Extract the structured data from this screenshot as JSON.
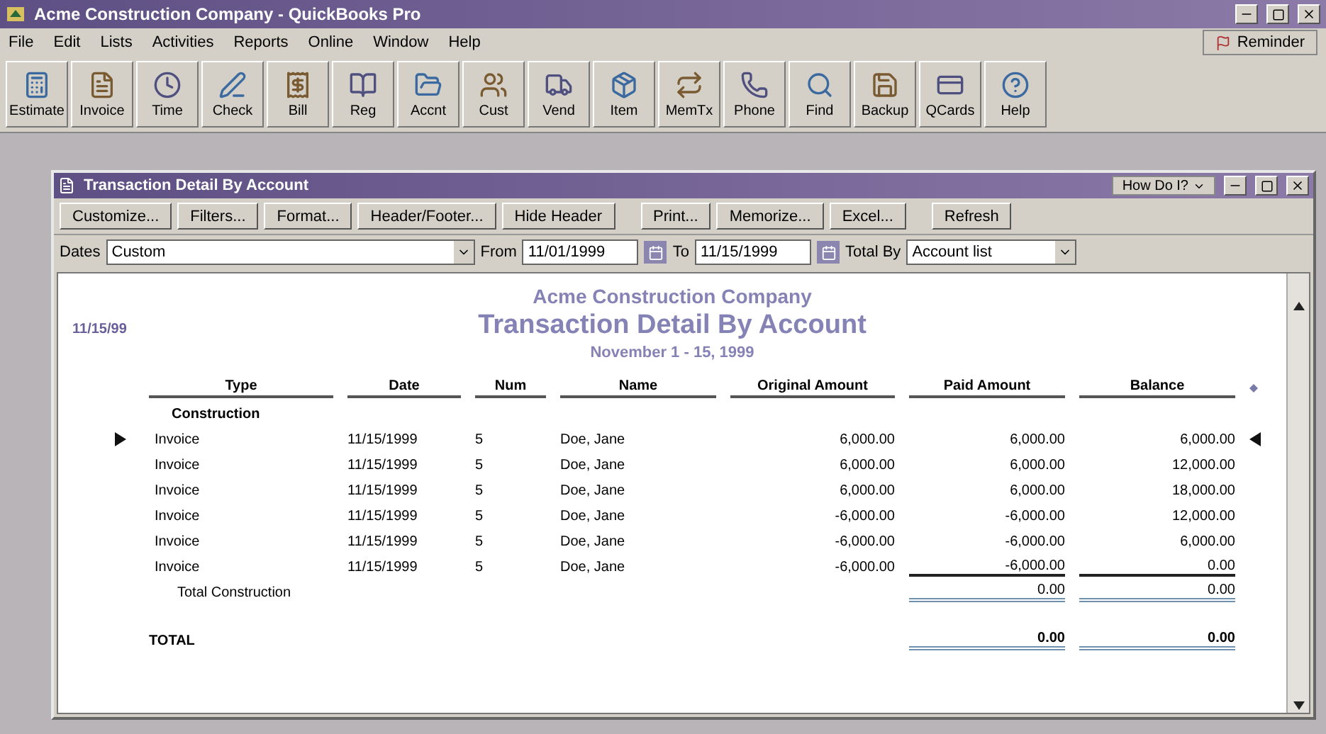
{
  "window": {
    "title": "Acme Construction Company - QuickBooks Pro"
  },
  "menu": [
    "File",
    "Edit",
    "Lists",
    "Activities",
    "Reports",
    "Online",
    "Window",
    "Help"
  ],
  "reminder": "Reminder",
  "toolbar": [
    "Estimate",
    "Invoice",
    "Time",
    "Check",
    "Bill",
    "Reg",
    "Accnt",
    "Cust",
    "Vend",
    "Item",
    "MemTx",
    "Phone",
    "Find",
    "Backup",
    "QCards",
    "Help"
  ],
  "report_window": {
    "title": "Transaction Detail By Account",
    "help": "How Do I?",
    "buttons": [
      "Customize...",
      "Filters...",
      "Format...",
      "Header/Footer...",
      "Hide Header",
      "Print...",
      "Memorize...",
      "Excel...",
      "Refresh"
    ],
    "filters": {
      "dates_label": "Dates",
      "dates": "Custom",
      "from_label": "From",
      "from": "11/01/1999",
      "to_label": "To",
      "to": "11/15/1999",
      "total_by_label": "Total By",
      "total_by": "Account list"
    }
  },
  "report": {
    "date": "11/15/99",
    "company": "Acme Construction Company",
    "title": "Transaction Detail By Account",
    "period": "November 1 - 15, 1999",
    "columns": [
      "Type",
      "Date",
      "Num",
      "Name",
      "Original Amount",
      "Paid Amount",
      "Balance"
    ],
    "sections": [
      {
        "name": "Construction",
        "rows": [
          {
            "cells": [
              "Invoice",
              "11/15/1999",
              "5",
              "Doe, Jane",
              "6,000.00",
              "6,000.00",
              "6,000.00"
            ],
            "selected": true
          },
          {
            "cells": [
              "Invoice",
              "11/15/1999",
              "5",
              "Doe, Jane",
              "6,000.00",
              "6,000.00",
              "12,000.00"
            ],
            "selected": false
          },
          {
            "cells": [
              "Invoice",
              "11/15/1999",
              "5",
              "Doe, Jane",
              "6,000.00",
              "6,000.00",
              "18,000.00"
            ],
            "selected": false
          },
          {
            "cells": [
              "Invoice",
              "11/15/1999",
              "5",
              "Doe, Jane",
              "-6,000.00",
              "-6,000.00",
              "12,000.00"
            ],
            "selected": false
          },
          {
            "cells": [
              "Invoice",
              "11/15/1999",
              "5",
              "Doe, Jane",
              "-6,000.00",
              "-6,000.00",
              "6,000.00"
            ],
            "selected": false
          },
          {
            "cells": [
              "Invoice",
              "11/15/1999",
              "5",
              "Doe, Jane",
              "-6,000.00",
              "-6,000.00",
              "0.00"
            ],
            "selected": false
          }
        ],
        "total_label": "Total Construction",
        "total_paid": "0.00",
        "total_balance": "0.00"
      }
    ],
    "grand_total": {
      "label": "TOTAL",
      "paid": "0.00",
      "balance": "0.00"
    }
  }
}
